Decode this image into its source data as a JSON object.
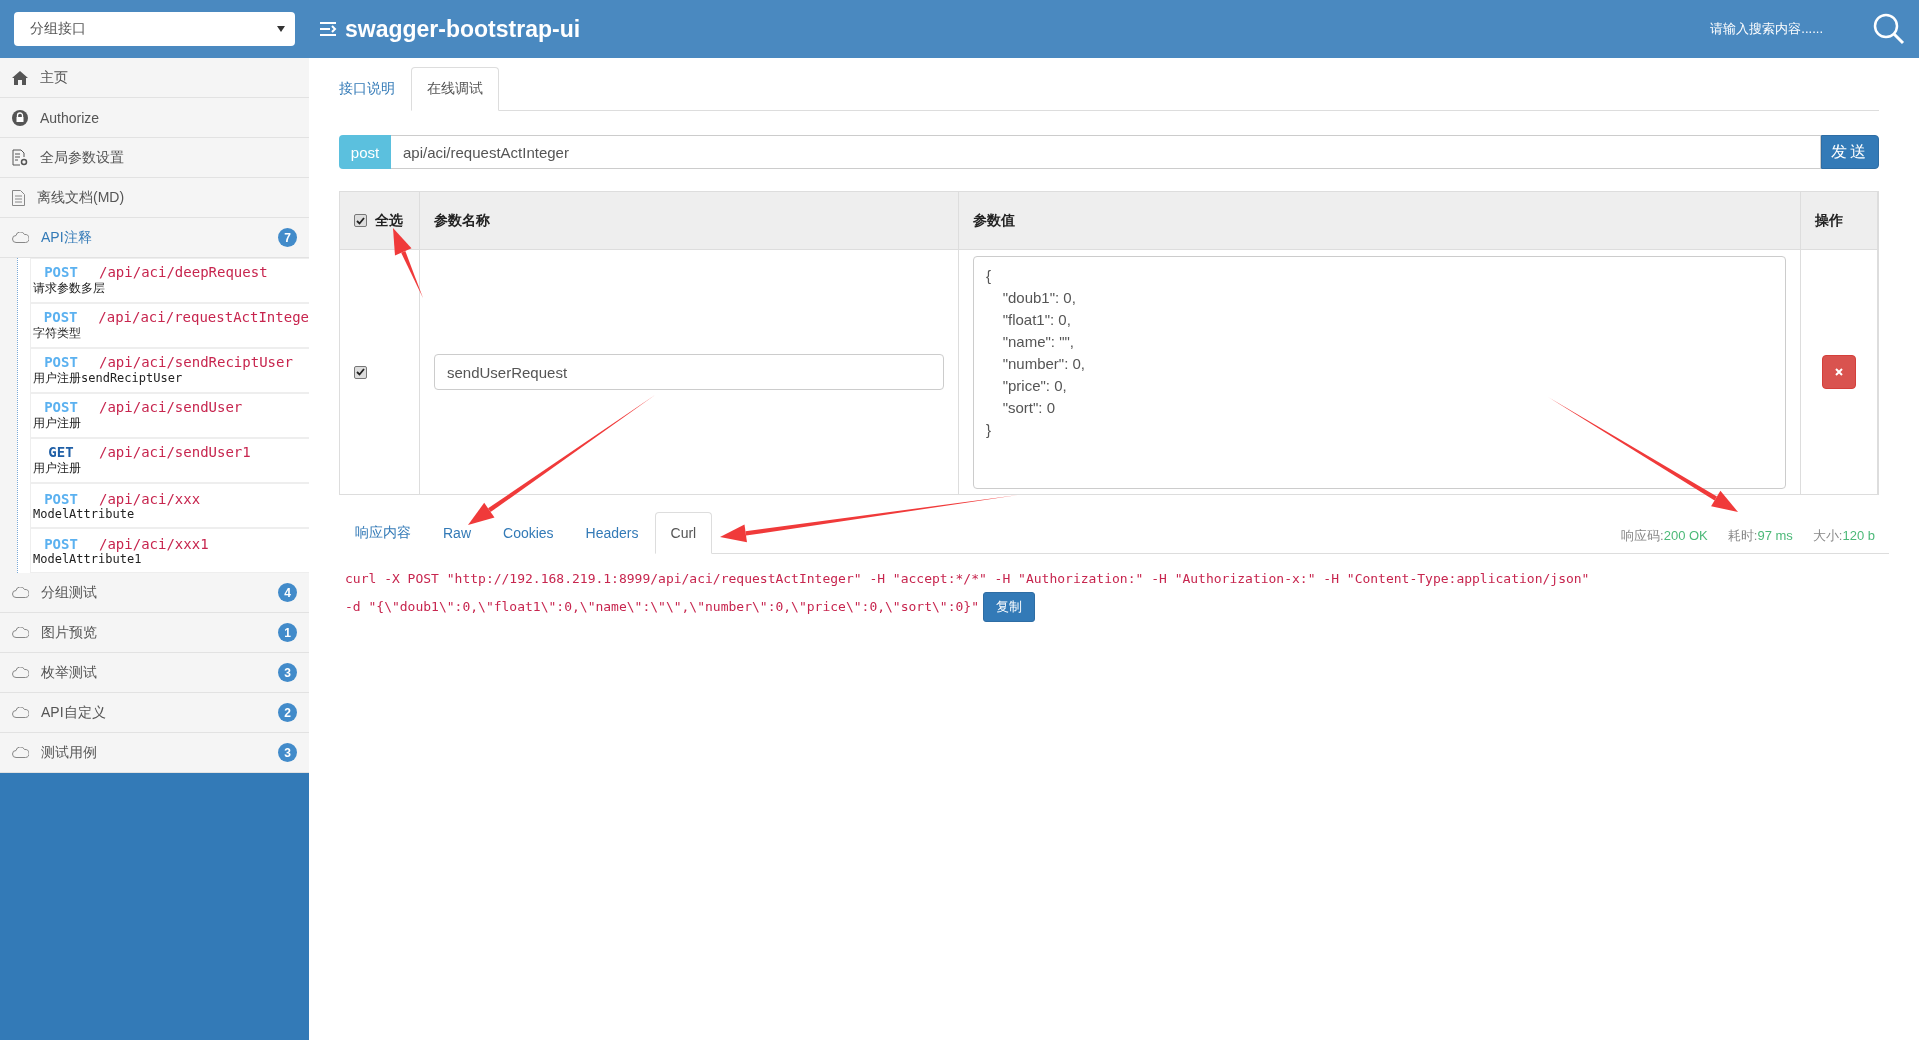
{
  "sidebar": {
    "group_select": "分组接口",
    "items": [
      {
        "kind": "home",
        "label": "主页"
      },
      {
        "kind": "lock",
        "label": "Authorize"
      },
      {
        "kind": "settings",
        "label": "全局参数设置"
      },
      {
        "kind": "document",
        "label": "离线文档(MD)"
      },
      {
        "kind": "group",
        "label": "API注释",
        "badge": "7",
        "expanded": true,
        "children": [
          {
            "method": "POST",
            "color": "#5bb1f0",
            "path": "/api/aci/deepRequest",
            "summary": "请求参数多层"
          },
          {
            "method": "POST",
            "color": "#5bb1f0",
            "path": "/api/aci/requestActIntege",
            "summary": "字符类型"
          },
          {
            "method": "POST",
            "color": "#5bb1f0",
            "path": "/api/aci/sendReciptUser",
            "summary": "用户注册sendReciptUser"
          },
          {
            "method": "POST",
            "color": "#5bb1f0",
            "path": "/api/aci/sendUser",
            "summary": "用户注册"
          },
          {
            "method": "GET",
            "color": "#1f5fa6",
            "path": "/api/aci/sendUser1",
            "summary": "用户注册"
          },
          {
            "method": "POST",
            "color": "#5bb1f0",
            "path": "/api/aci/xxx",
            "summary": "ModelAttribute"
          },
          {
            "method": "POST",
            "color": "#5bb1f0",
            "path": "/api/aci/xxx1",
            "summary": "ModelAttribute1"
          }
        ]
      },
      {
        "kind": "group",
        "label": "分组测试",
        "badge": "4",
        "expanded": false
      },
      {
        "kind": "group",
        "label": "图片预览",
        "badge": "1",
        "expanded": false
      },
      {
        "kind": "group",
        "label": "枚举测试",
        "badge": "3",
        "expanded": false
      },
      {
        "kind": "group",
        "label": "API自定义",
        "badge": "2",
        "expanded": false
      },
      {
        "kind": "group",
        "label": "测试用例",
        "badge": "3",
        "expanded": false
      }
    ]
  },
  "header": {
    "title": "swagger-bootstrap-ui",
    "search_placeholder": "请输入搜索内容......"
  },
  "tabs": [
    {
      "label": "接口说明",
      "selected": false
    },
    {
      "label": "在线调试",
      "selected": true
    }
  ],
  "request": {
    "method": "post",
    "url": "api/aci/requestActInteger",
    "send_button": "发送"
  },
  "params_table": {
    "select_all": {
      "label": "全选",
      "checked": true
    },
    "columns": [
      "参数名称",
      "参数值",
      "操作"
    ],
    "rows": [
      {
        "checked": true,
        "name": "sendUserRequest",
        "value": "{\n    \"doub1\": 0,\n    \"float1\": 0,\n    \"name\": \"\",\n    \"number\": 0,\n    \"price\": 0,\n    \"sort\": 0\n}"
      }
    ]
  },
  "response_tabs": [
    {
      "label": "响应内容",
      "selected": false
    },
    {
      "label": "Raw",
      "selected": false
    },
    {
      "label": "Cookies",
      "selected": false
    },
    {
      "label": "Headers",
      "selected": false
    },
    {
      "label": "Curl",
      "selected": true
    }
  ],
  "response_stats": [
    {
      "label": "响应码:",
      "value": "200 OK"
    },
    {
      "label": "耗时:",
      "value": "97 ms"
    },
    {
      "label": "大小:",
      "value": "120 b"
    }
  ],
  "curl": {
    "command": "curl -X POST \"http://192.168.219.1:8999/api/aci/requestActInteger\" -H \"accept:*/*\" -H \"Authorization:\" -H \"Authorization-x:\" -H \"Content-Type:application/json\" -d \"{\\\"doub1\\\":0,\\\"float1\\\":0,\\\"name\\\":\\\"\\\",\\\"number\\\":0,\\\"price\\\":0,\\\"sort\\\":0}\"",
    "copy_button": "复制"
  }
}
